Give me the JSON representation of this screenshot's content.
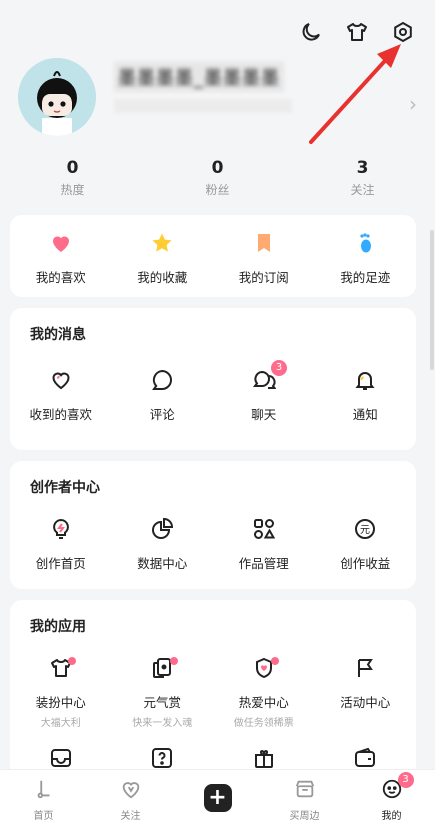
{
  "profile": {
    "username": "墨墨墨墨_墨墨墨墨",
    "subtitle": ""
  },
  "stats": [
    {
      "value": "0",
      "label": "热度"
    },
    {
      "value": "0",
      "label": "粉丝"
    },
    {
      "value": "3",
      "label": "关注"
    }
  ],
  "quick": [
    {
      "label": "我的喜欢",
      "icon": "heart-icon",
      "color": "#ff6b8b"
    },
    {
      "label": "我的收藏",
      "icon": "star-icon",
      "color": "#ffcc33"
    },
    {
      "label": "我的订阅",
      "icon": "bookmark-icon",
      "color": "#ffaa70"
    },
    {
      "label": "我的足迹",
      "icon": "footprint-icon",
      "color": "#33aaff"
    }
  ],
  "messages": {
    "title": "我的消息",
    "items": [
      {
        "label": "收到的喜欢"
      },
      {
        "label": "评论"
      },
      {
        "label": "聊天",
        "badge": "3"
      },
      {
        "label": "通知"
      }
    ]
  },
  "creator": {
    "title": "创作者中心",
    "items": [
      {
        "label": "创作首页"
      },
      {
        "label": "数据中心"
      },
      {
        "label": "作品管理"
      },
      {
        "label": "创作收益"
      }
    ]
  },
  "apps": {
    "title": "我的应用",
    "items": [
      {
        "label": "装扮中心",
        "sub": "大福大利"
      },
      {
        "label": "元气赏",
        "sub": "快来一发入魂"
      },
      {
        "label": "热爱中心",
        "sub": "做任务领稀票"
      },
      {
        "label": "活动中心",
        "sub": ""
      }
    ]
  },
  "nav": [
    {
      "label": "首页"
    },
    {
      "label": "关注"
    },
    {
      "label": "+"
    },
    {
      "label": "买周边"
    },
    {
      "label": "我的",
      "badge": "3"
    }
  ],
  "colors": {
    "accent": "#ff6b8b",
    "arrow": "#e8322f"
  }
}
